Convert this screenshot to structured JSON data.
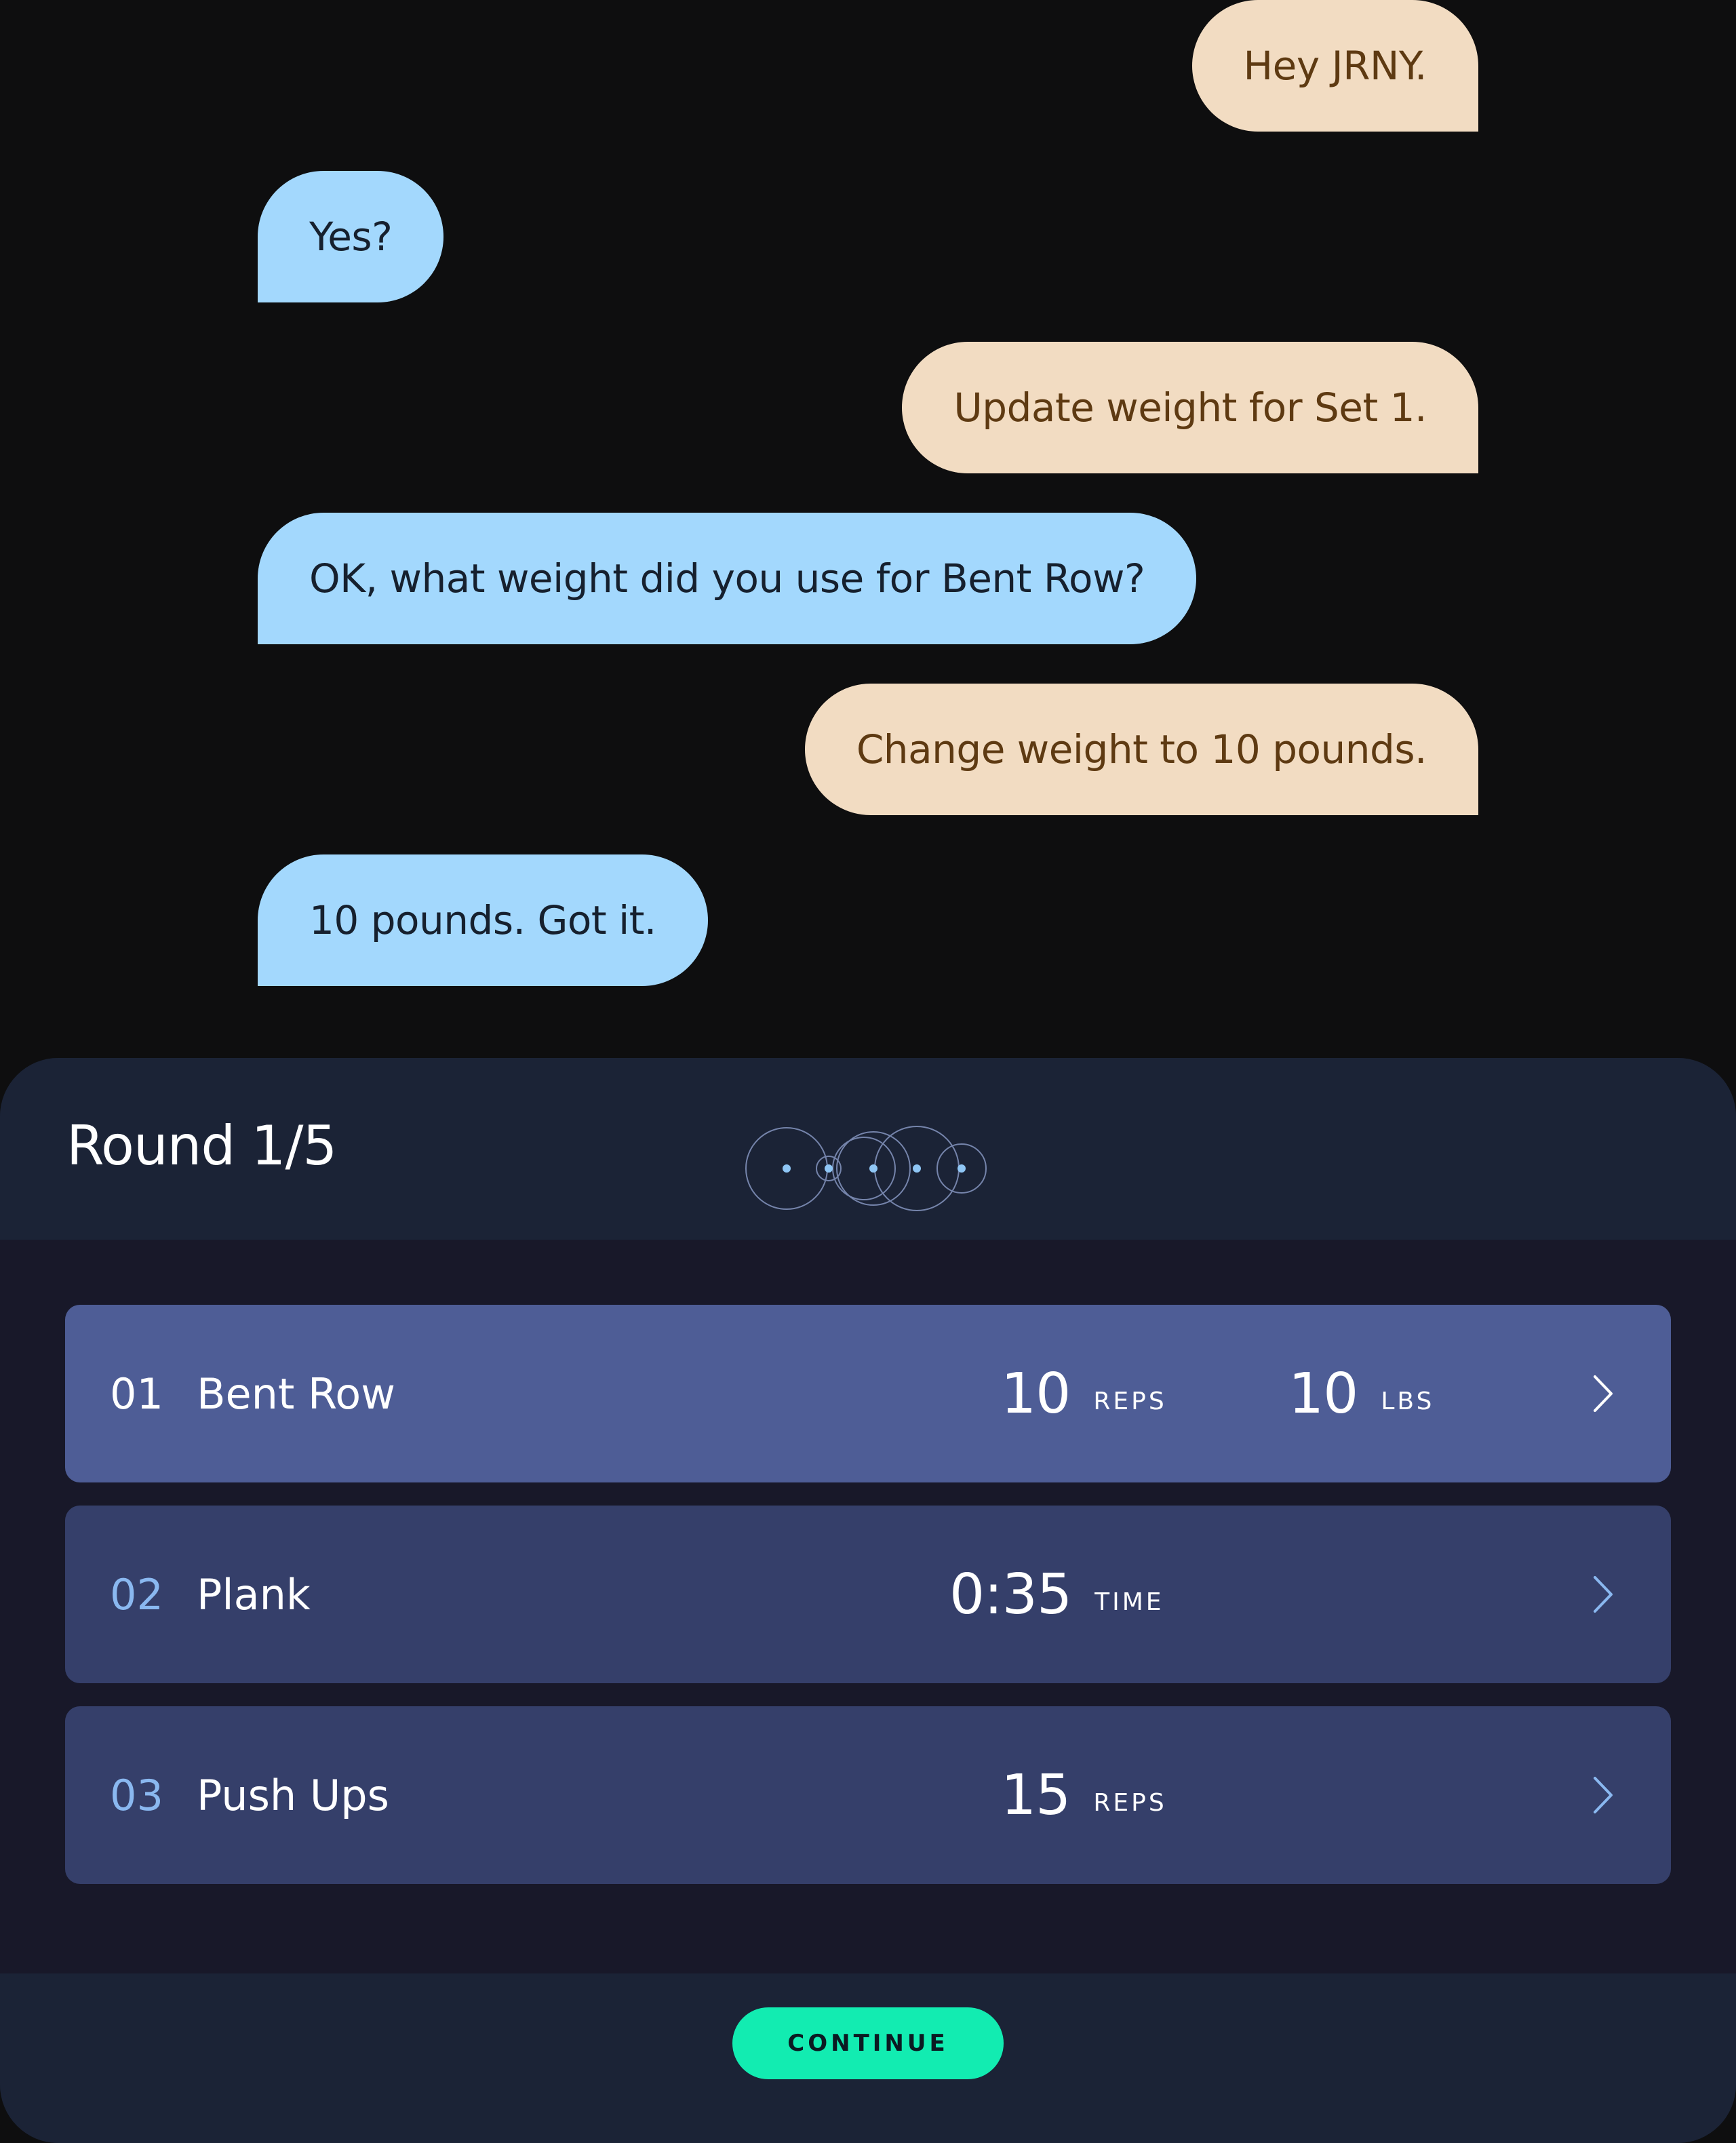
{
  "chat": {
    "messages": [
      {
        "sender": "user",
        "text": "Hey JRNY."
      },
      {
        "sender": "assistant",
        "text": "Yes?"
      },
      {
        "sender": "user",
        "text": "Update weight for Set 1."
      },
      {
        "sender": "assistant",
        "text": "OK, what weight did you use for Bent Row?"
      },
      {
        "sender": "user",
        "text": "Change weight to 10 pounds."
      },
      {
        "sender": "assistant",
        "text": "10 pounds. Got it."
      }
    ]
  },
  "workout": {
    "round_label": "Round 1/5",
    "exercises": [
      {
        "number": "01",
        "name": "Bent Row",
        "metric1_value": "10",
        "metric1_unit": "REPS",
        "metric2_value": "10",
        "metric2_unit": "LBS",
        "active": true
      },
      {
        "number": "02",
        "name": "Plank",
        "metric1_value": "0:35",
        "metric1_unit": "TIME",
        "active": false
      },
      {
        "number": "03",
        "name": "Push Ups",
        "metric1_value": "15",
        "metric1_unit": "REPS",
        "active": false
      }
    ],
    "continue_label": "CONTINUE"
  },
  "colors": {
    "user_bubble": "#f2dcc2",
    "assistant_bubble": "#a3d8fd",
    "active_row": "#4e5d96",
    "row": "#353f6a",
    "continue_button": "#12ecb1"
  },
  "icons": {
    "listening_indicator": "voice-orb-icon",
    "row_chevron": "chevron-right-icon"
  }
}
